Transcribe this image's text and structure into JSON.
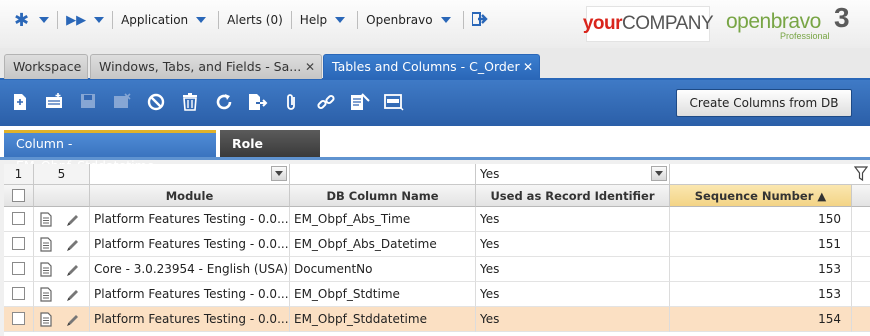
{
  "nav": {
    "items": [
      {
        "label": "Application"
      },
      {
        "label": "Alerts (0)"
      },
      {
        "label": "Help"
      },
      {
        "label": "Openbravo"
      }
    ]
  },
  "branding": {
    "company_logo_a": "your",
    "company_logo_b": "COMPANY",
    "product_logo": "openbravo",
    "product_edition": "Professional",
    "product_mark": "3"
  },
  "tabs": [
    {
      "label": "Workspace",
      "active": false,
      "closable": false
    },
    {
      "label": "Windows, Tabs, and Fields - Sa...",
      "active": false,
      "closable": true
    },
    {
      "label": "Tables and Columns - C_Order",
      "active": true,
      "closable": true
    }
  ],
  "toolbar": {
    "create_button_label": "Create Columns from DB",
    "icons": [
      "new-document-icon",
      "new-row-icon",
      "save-icon",
      "undo-icon",
      "delete-block-icon",
      "trash-icon",
      "refresh-icon",
      "export-icon",
      "attachment-icon",
      "link-icon",
      "audit-icon",
      "grid-view-icon"
    ]
  },
  "subtabs": [
    {
      "label": "Column - EM_Obpf_Stddatetime",
      "active": true
    },
    {
      "label": "Role Access",
      "active": false
    }
  ],
  "grid": {
    "filter_row": {
      "selected_count": "1",
      "total_count": "5",
      "record_identifier_filter": "Yes"
    },
    "columns": [
      {
        "label": "Module"
      },
      {
        "label": "DB Column Name"
      },
      {
        "label": "Used as Record Identifier"
      },
      {
        "label": "Sequence Number ▲"
      }
    ],
    "sorted_column": "Sequence Number",
    "rows": [
      {
        "module": "Platform Features Testing - 0.0....",
        "db_column": "EM_Obpf_Abs_Time",
        "identifier": "Yes",
        "sequence": "150",
        "selected": false
      },
      {
        "module": "Platform Features Testing - 0.0....",
        "db_column": "EM_Obpf_Abs_Datetime",
        "identifier": "Yes",
        "sequence": "151",
        "selected": false
      },
      {
        "module": "Core - 3.0.23954 - English (USA)",
        "db_column": "DocumentNo",
        "identifier": "Yes",
        "sequence": "153",
        "selected": false
      },
      {
        "module": "Platform Features Testing - 0.0....",
        "db_column": "EM_Obpf_Stdtime",
        "identifier": "Yes",
        "sequence": "153",
        "selected": false
      },
      {
        "module": "Platform Features Testing - 0.0....",
        "db_column": "EM_Obpf_Stddatetime",
        "identifier": "Yes",
        "sequence": "154",
        "selected": true
      }
    ]
  },
  "colors": {
    "accent": "#2a67b8",
    "toolbar": "#3468b3",
    "selected_row": "#fbe0c3",
    "sorted_header": "#f3d486"
  }
}
